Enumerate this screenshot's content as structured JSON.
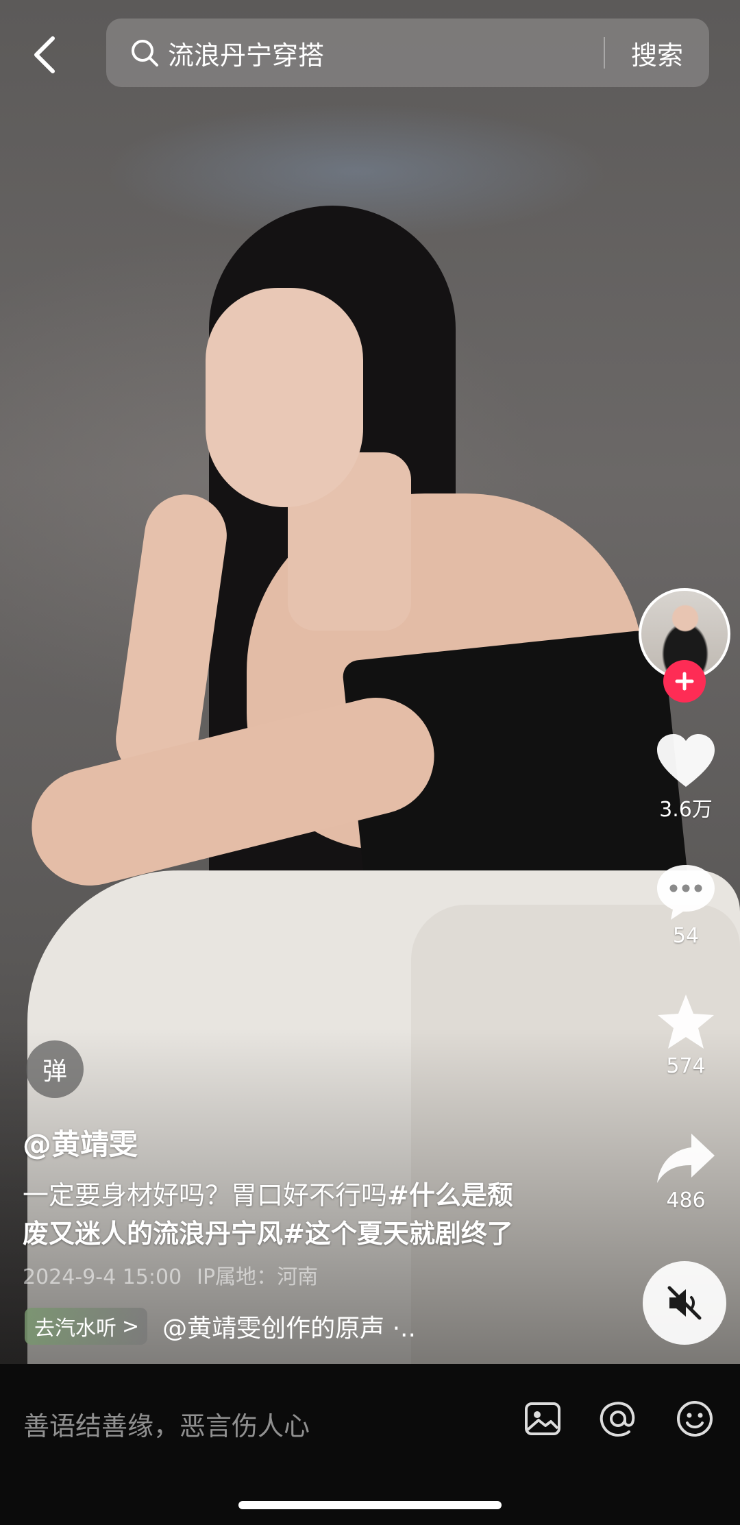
{
  "search": {
    "query": "流浪丹宁穿搭",
    "button_label": "搜索"
  },
  "author": {
    "handle": "@黄靖雯"
  },
  "caption": {
    "line1": "一定要身材好吗？胃口好不行吗",
    "tag1": "#什么是颓",
    "line2_tag1_cont": "废又迷人的流浪丹宁风",
    "tag2": "#这个夏天就剧终了"
  },
  "meta": {
    "datetime": "2024-9-4 15:00",
    "ip_location": "IP属地：河南"
  },
  "music": {
    "pill_label": "去汽水听",
    "pill_arrow": ">",
    "title": "@黄靖雯创作的原声 ·.."
  },
  "danmaku": {
    "label": "弹"
  },
  "actions": {
    "likes": "3.6万",
    "comments": "54",
    "favorites": "574",
    "shares": "486"
  },
  "comment_bar": {
    "placeholder": "善语结善缘，恶言伤人心"
  },
  "colors": {
    "follow_red": "#fe2c55",
    "comment_bar_bg": "#0b0b0b"
  },
  "icons": [
    "chevron-left-icon",
    "search-icon",
    "plus-icon",
    "heart-icon",
    "comment-icon",
    "star-icon",
    "share-icon",
    "mute-icon",
    "image-icon",
    "at-icon",
    "emoji-icon"
  ]
}
